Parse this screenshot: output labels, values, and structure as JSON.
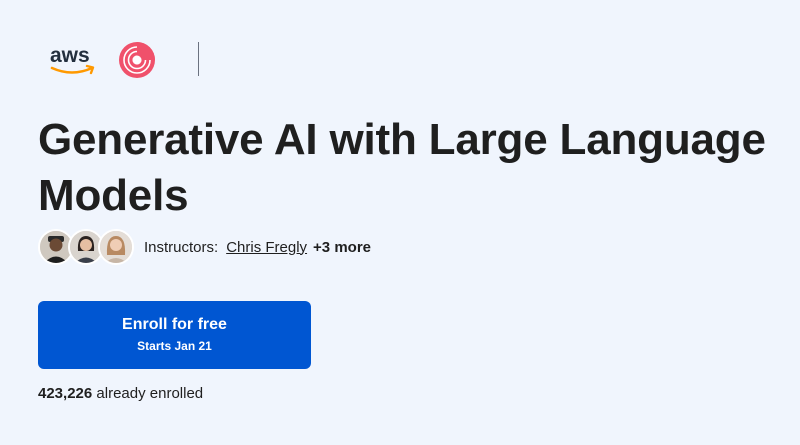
{
  "logos": {
    "aws_text": "aws"
  },
  "course": {
    "title": "Generative AI with Large Language Models"
  },
  "instructors": {
    "label": "Instructors:",
    "primary_name": "Chris Fregly",
    "more_label": "+3 more"
  },
  "enroll": {
    "main_label": "Enroll for free",
    "sub_label": "Starts Jan 21"
  },
  "enrollment": {
    "count": "423,226",
    "suffix": "already enrolled"
  },
  "colors": {
    "background": "#f0f5fd",
    "button": "#0056d2",
    "aws_orange": "#ff9900",
    "deeplearn_red": "#f0516b"
  }
}
